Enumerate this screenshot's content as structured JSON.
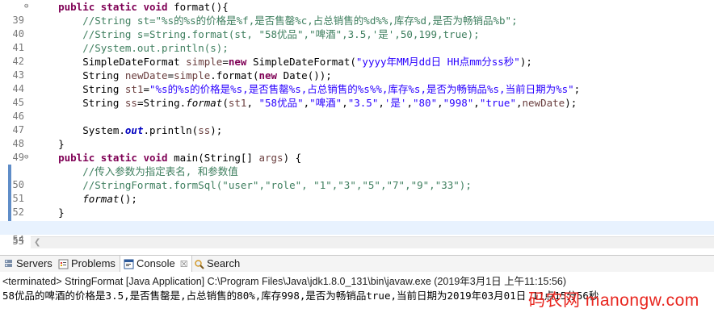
{
  "editor": {
    "lines": [
      {
        "num": "39",
        "fold": "⊖",
        "text": "    public static void format(){"
      },
      {
        "num": "40",
        "text": "        //String st=\"%s的%s的价格是%f,是否售罄%c,占总销售的%d%%,库存%d,是否为畅销品%b\";"
      },
      {
        "num": "41",
        "text": "        //String s=String.format(st, \"58优品\",\"啤酒\",3.5,'是',50,199,true);"
      },
      {
        "num": "42",
        "text": "        //System.out.println(s);"
      },
      {
        "num": "43",
        "text": "        SimpleDateFormat simple=new SimpleDateFormat(\"yyyy年MM月dd日 HH点mm分ss秒\");"
      },
      {
        "num": "44",
        "text": "        String newDate=simple.format(new Date());"
      },
      {
        "num": "45",
        "text": "        String st1=\"%s的%s的价格是%s,是否售罄%s,占总销售的%s%%,库存%s,是否为畅销品%s,当前日期为%s\";"
      },
      {
        "num": "46",
        "text": "        String ss=String.format(st1, \"58优品\",\"啤酒\",\"3.5\",'是',\"80\",\"998\",\"true\",newDate);"
      },
      {
        "num": "47",
        "text": ""
      },
      {
        "num": "48",
        "text": "        System.out.println(ss);"
      },
      {
        "num": "49",
        "text": "    }"
      },
      {
        "num": "50",
        "fold": "⊖",
        "text": "    public static void main(String[] args) {"
      },
      {
        "num": "51",
        "text": "        //传入参数为指定表名, 和参数值"
      },
      {
        "num": "52",
        "text": "        //StringFormat.formSql(\"user\",\"role\", \"1\",\"3\",\"5\",\"7\",\"9\",\"33\");"
      },
      {
        "num": "53",
        "text": "        format();"
      },
      {
        "num": "54",
        "text": "    }"
      },
      {
        "num": "55",
        "text": ""
      }
    ]
  },
  "tabs": [
    {
      "label": "Servers",
      "icon": "servers-icon"
    },
    {
      "label": "Problems",
      "icon": "problems-icon"
    },
    {
      "label": "Console",
      "icon": "console-icon",
      "close": "☒"
    },
    {
      "label": "Search",
      "icon": "search-icon"
    }
  ],
  "console": {
    "header": "<terminated> StringFormat [Java Application] C:\\Program Files\\Java\\jdk1.8.0_131\\bin\\javaw.exe (2019年3月1日 上午11:15:56)",
    "output": "58优品的啤酒的价格是3.5,是否售罄是,占总销售的80%,库存998,是否为畅销品true,当前日期为2019年03月01日 11点15分56秒"
  },
  "watermark": "码农网 manongw.com",
  "colors": {
    "keyword": "#7f0055",
    "comment": "#3f7f5f",
    "string": "#2a00ff",
    "field": "#0000c0",
    "watermark": "#e8261f"
  }
}
